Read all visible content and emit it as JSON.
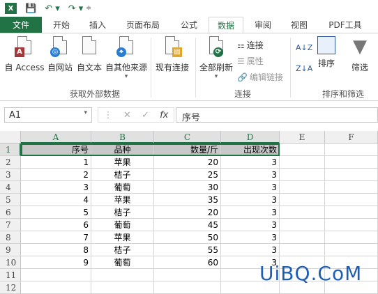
{
  "qab": {
    "excel_badge": "X",
    "save": "💾",
    "undo": "↶ ▾",
    "redo": "↷ ▾",
    "customize": "≑"
  },
  "tabs": [
    "文件",
    "开始",
    "插入",
    "页面布局",
    "公式",
    "数据",
    "审阅",
    "视图",
    "PDF工具"
  ],
  "ribbon": {
    "get_external": {
      "access": "自 Access",
      "web": "自网站",
      "text": "自文本",
      "other": "自其他来源",
      "group": "获取外部数据"
    },
    "existing": "现有连接",
    "connections": {
      "refresh_all": "全部刷新",
      "connect": "连接",
      "props": "属性",
      "edit_links": "编辑链接",
      "group": "连接"
    },
    "sort": {
      "sort": "排序",
      "filter": "筛选",
      "group": "排序和筛选"
    }
  },
  "formula_bar": {
    "name_box": "A1",
    "fx": "fx",
    "content": "序号"
  },
  "columns": [
    "A",
    "B",
    "C",
    "D",
    "E",
    "F"
  ],
  "rows": [
    "1",
    "2",
    "3",
    "4",
    "5",
    "6",
    "7",
    "8",
    "9",
    "10",
    "11",
    "12"
  ],
  "table": {
    "headers": [
      "序号",
      "品种",
      "数量/斤",
      "出现次数"
    ],
    "rows": [
      [
        "1",
        "苹果",
        "20",
        "3"
      ],
      [
        "2",
        "桔子",
        "25",
        "3"
      ],
      [
        "3",
        "葡萄",
        "30",
        "3"
      ],
      [
        "4",
        "苹果",
        "35",
        "3"
      ],
      [
        "5",
        "桔子",
        "20",
        "3"
      ],
      [
        "6",
        "葡萄",
        "45",
        "3"
      ],
      [
        "7",
        "苹果",
        "50",
        "3"
      ],
      [
        "8",
        "桔子",
        "55",
        "3"
      ],
      [
        "9",
        "葡萄",
        "60",
        "3"
      ]
    ]
  },
  "watermark": "UiBQ.CoM",
  "colors": {
    "accent": "#217346",
    "header_fill": "#c8c8c8"
  }
}
